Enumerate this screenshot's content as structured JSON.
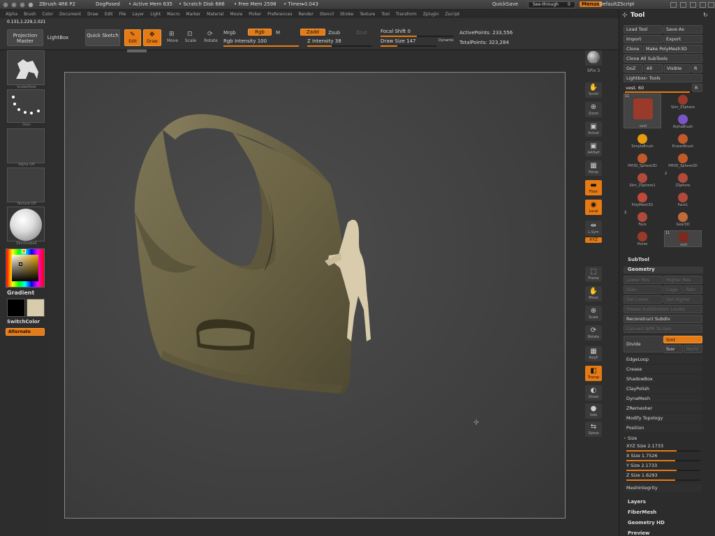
{
  "titlebar": {
    "app": "ZBrush 4R6 P2",
    "doc": "DogPosed",
    "active_mem": "• Active Mem 635",
    "scratch_disk": "• Scratch Disk 686",
    "free_mem": "• Free Mem 2598",
    "timer": "• Timer▸0.043",
    "quicksave": "QuickSave",
    "see_through": "See-through",
    "see_through_value": "0",
    "menus": "Menus",
    "default_script": "DefaultZScript"
  },
  "menubar": [
    "Alpha",
    "Brush",
    "Color",
    "Document",
    "Draw",
    "Edit",
    "File",
    "Layer",
    "Light",
    "Macro",
    "Marker",
    "Material",
    "Movie",
    "Picker",
    "Preferences",
    "Render",
    "Stencil",
    "Stroke",
    "Texture",
    "Tool",
    "Transform",
    "Zplugin",
    "Zscript"
  ],
  "coords": "0.131,1.229,1.021",
  "shelf": {
    "projection_master": "Projection Master",
    "lightbox": "LightBox",
    "quick_sketch": "Quick Sketch",
    "edit": "Edit",
    "draw": "Draw",
    "move": "Move",
    "scale": "Scale",
    "rotate": "Rotate",
    "mrgb": "Mrgb",
    "rgb": "Rgb",
    "m": "M",
    "rgb_intensity_label": "Rgb Intensity",
    "rgb_intensity": "100",
    "zadd": "Zadd",
    "zsub": "Zsub",
    "zcut": "Zcut",
    "z_intensity_label": "Z Intensity",
    "z_intensity": "38",
    "focal_shift_label": "Focal Shift",
    "focal_shift": "0",
    "draw_size_label": "Draw Size",
    "draw_size": "147",
    "dynamic": "Dynamic",
    "active_points": "ActivePoints: 233,556",
    "total_points": "TotalPoints: 323,284"
  },
  "lefttray": {
    "brush_caption": "SnakeHook",
    "stroke_caption": "Dots",
    "alpha_caption": "Alpha Off",
    "texture_caption": "Texture Off",
    "material_caption": "SkinShade4",
    "gradient": "Gradient",
    "switchcolor": "SwitchColor",
    "alternate": "Alternate"
  },
  "rshelf": {
    "bpr": "BPR",
    "spix": "SPix",
    "spix_value": "3",
    "scroll": "Scroll",
    "zoom": "Zoom",
    "actual": "Actual",
    "aahalf": "AAHalf",
    "persp": "Persp",
    "floor": "Floor",
    "local": "Local",
    "lsym": "L.Sym",
    "xyz": "XYZ",
    "frame": "Frame",
    "move": "Move",
    "scale": "Scale",
    "rotate": "Rotate",
    "polyf": "PolyF",
    "transp": "Transp",
    "ghost": "Ghost",
    "solo": "Solo",
    "xpose": "Xpose"
  },
  "toolpanel": {
    "title": "Tool",
    "load_tool": "Load Tool",
    "save_as": "Save As",
    "import": "Import",
    "export": "Export",
    "clone": "Clone",
    "make_polymesh": "Make PolyMesh3D",
    "clone_all": "Clone  All  SubTools",
    "goz": "GoZ",
    "all": "All",
    "visible": "Visible",
    "r": "R",
    "lightbox_tools": "Lightbox› Tools",
    "current_tool": "vest. 60",
    "r2": "R",
    "tools": [
      {
        "name": "vest",
        "count": "11"
      },
      {
        "name": "Skin_ZSphere",
        "count": ""
      },
      {
        "name": "AlphaBrush",
        "count": ""
      },
      {
        "name": "SimpleBrush",
        "count": ""
      },
      {
        "name": "EraserBrush",
        "count": ""
      },
      {
        "name": "PM3D_Sphere3D",
        "count": ""
      },
      {
        "name": "PM3D_Sphere3D",
        "count": ""
      },
      {
        "name": "Skin_ZSphere1",
        "count": ""
      },
      {
        "name": "ZSphere",
        "count": "2"
      },
      {
        "name": "PolyMesh3D",
        "count": ""
      },
      {
        "name": "Face1",
        "count": ""
      },
      {
        "name": "Face",
        "count": "3"
      },
      {
        "name": "Gear3D",
        "count": ""
      },
      {
        "name": "Horse",
        "count": ""
      },
      {
        "name": "vest",
        "count": "11"
      }
    ],
    "subtool": "SubTool",
    "geometry": "Geometry",
    "lower_res": "Lower Res",
    "higher_res": "Higher Res",
    "sdiv": "SDiv",
    "cage": "Cage",
    "rstr": "Rstr",
    "del_lower": "Del Lower",
    "del_higher": "Del Higher",
    "freeze_subdiv": "Freeze SubDivision Levels",
    "reconstruct_subdiv": "Reconstruct Subdiv",
    "convert_bpr": "Convert BPR To Geo",
    "divide": "Divide",
    "smt": "Smt",
    "suv": "Suv",
    "reuv": "ReUV",
    "edgeloop": "EdgeLoop",
    "crease": "Crease",
    "shadowbox": "ShadowBox",
    "claypolish": "ClayPolish",
    "dynamesh": "DynaMesh",
    "zremesher": "ZRemesher",
    "modify_topology": "Modify  Topology",
    "position": "Position",
    "size": "Size",
    "xyz_size": "XYZ Size 2.1733",
    "x_size": "X Size 1.7526",
    "y_size": "Y Size 2.1733",
    "z_size": "Z Size 1.6293",
    "mesh_integrity": "MeshIntegrity",
    "layers": "Layers",
    "fibermesh": "FiberMesh",
    "geometry_hd": "Geometry HD",
    "preview": "Preview"
  },
  "colors": {
    "accent": "#e67a14",
    "model": "#6b6344",
    "horse": "#d8ccad"
  }
}
